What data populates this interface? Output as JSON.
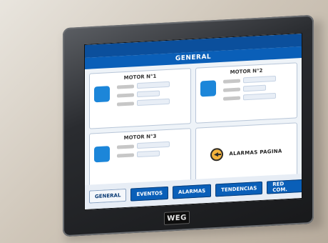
{
  "screen": {
    "header_title": "GENERAL",
    "top_right": [
      "",
      ""
    ],
    "panels": [
      {
        "title": "MOTOR N°1"
      },
      {
        "title": "MOTOR N°2"
      },
      {
        "title": "MOTOR N°3"
      },
      {
        "title": "ALARMAS PAGINA"
      }
    ],
    "tabs": [
      {
        "label": "GENERAL",
        "active": true
      },
      {
        "label": "EVENTOS",
        "active": false
      },
      {
        "label": "ALARMAS",
        "active": false
      },
      {
        "label": "TENDENCIAS",
        "active": false
      },
      {
        "label": "RED COM.",
        "active": false
      }
    ]
  },
  "device": {
    "brand_logo_text": "WEG"
  },
  "icons": {
    "motor_icon": "motor-icon",
    "back_icon": "back-arrow-icon"
  },
  "colors": {
    "primary_blue": "#0a5fb8",
    "dark_blue": "#0b4f9c",
    "accent_orange": "#f3b23b"
  }
}
